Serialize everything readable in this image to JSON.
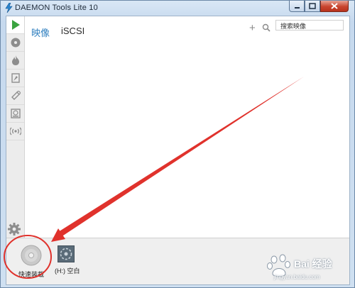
{
  "window": {
    "title": "DAEMON Tools Lite 10",
    "buttons": [
      "minimize",
      "maximize",
      "close"
    ]
  },
  "sidebar": {
    "items": [
      {
        "icon": "play-icon",
        "active": true
      },
      {
        "icon": "disc-icon"
      },
      {
        "icon": "flame-icon"
      },
      {
        "icon": "image-editor-icon"
      },
      {
        "icon": "usb-icon"
      },
      {
        "icon": "virtual-hdd-icon"
      },
      {
        "icon": "network-icon"
      }
    ],
    "bottom_icon": "gear-icon"
  },
  "main": {
    "tabs": [
      {
        "label": "映像",
        "active": true
      },
      {
        "label": "iSCSI"
      }
    ],
    "add_icon": "plus-icon",
    "search": {
      "placeholder": "搜索映像"
    }
  },
  "bottom": {
    "quick_mount": {
      "label": "快速装载",
      "icon": "disc-icon"
    },
    "drives": [
      {
        "label": "(H:) 空白",
        "icon": "virtual-drive-icon"
      }
    ]
  },
  "annotations": {
    "arrow_color": "#e0322c",
    "circle_color": "#e0322c"
  },
  "watermark": {
    "text": "Bai 经验",
    "url": "jingyan.baidu.com"
  },
  "colors": {
    "accent": "#2f7fbf",
    "play_green": "#3aa33f"
  }
}
